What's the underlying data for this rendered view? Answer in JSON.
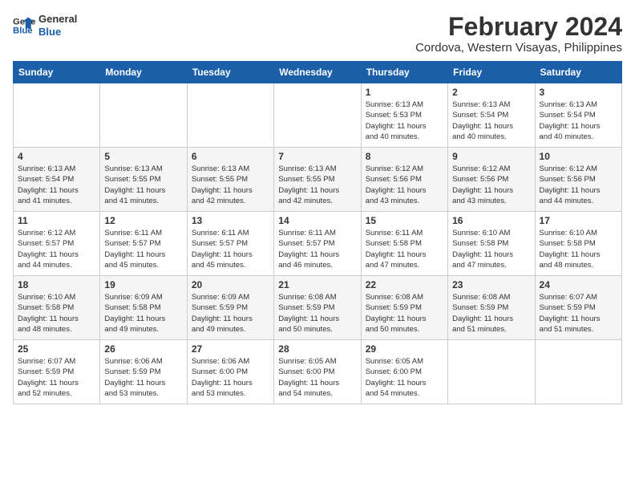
{
  "logo": {
    "line1": "General",
    "line2": "Blue"
  },
  "title": "February 2024",
  "subtitle": "Cordova, Western Visayas, Philippines",
  "days_of_week": [
    "Sunday",
    "Monday",
    "Tuesday",
    "Wednesday",
    "Thursday",
    "Friday",
    "Saturday"
  ],
  "weeks": [
    [
      {
        "day": "",
        "info": ""
      },
      {
        "day": "",
        "info": ""
      },
      {
        "day": "",
        "info": ""
      },
      {
        "day": "",
        "info": ""
      },
      {
        "day": "1",
        "info": "Sunrise: 6:13 AM\nSunset: 5:53 PM\nDaylight: 11 hours\nand 40 minutes."
      },
      {
        "day": "2",
        "info": "Sunrise: 6:13 AM\nSunset: 5:54 PM\nDaylight: 11 hours\nand 40 minutes."
      },
      {
        "day": "3",
        "info": "Sunrise: 6:13 AM\nSunset: 5:54 PM\nDaylight: 11 hours\nand 40 minutes."
      }
    ],
    [
      {
        "day": "4",
        "info": "Sunrise: 6:13 AM\nSunset: 5:54 PM\nDaylight: 11 hours\nand 41 minutes."
      },
      {
        "day": "5",
        "info": "Sunrise: 6:13 AM\nSunset: 5:55 PM\nDaylight: 11 hours\nand 41 minutes."
      },
      {
        "day": "6",
        "info": "Sunrise: 6:13 AM\nSunset: 5:55 PM\nDaylight: 11 hours\nand 42 minutes."
      },
      {
        "day": "7",
        "info": "Sunrise: 6:13 AM\nSunset: 5:55 PM\nDaylight: 11 hours\nand 42 minutes."
      },
      {
        "day": "8",
        "info": "Sunrise: 6:12 AM\nSunset: 5:56 PM\nDaylight: 11 hours\nand 43 minutes."
      },
      {
        "day": "9",
        "info": "Sunrise: 6:12 AM\nSunset: 5:56 PM\nDaylight: 11 hours\nand 43 minutes."
      },
      {
        "day": "10",
        "info": "Sunrise: 6:12 AM\nSunset: 5:56 PM\nDaylight: 11 hours\nand 44 minutes."
      }
    ],
    [
      {
        "day": "11",
        "info": "Sunrise: 6:12 AM\nSunset: 5:57 PM\nDaylight: 11 hours\nand 44 minutes."
      },
      {
        "day": "12",
        "info": "Sunrise: 6:11 AM\nSunset: 5:57 PM\nDaylight: 11 hours\nand 45 minutes."
      },
      {
        "day": "13",
        "info": "Sunrise: 6:11 AM\nSunset: 5:57 PM\nDaylight: 11 hours\nand 45 minutes."
      },
      {
        "day": "14",
        "info": "Sunrise: 6:11 AM\nSunset: 5:57 PM\nDaylight: 11 hours\nand 46 minutes."
      },
      {
        "day": "15",
        "info": "Sunrise: 6:11 AM\nSunset: 5:58 PM\nDaylight: 11 hours\nand 47 minutes."
      },
      {
        "day": "16",
        "info": "Sunrise: 6:10 AM\nSunset: 5:58 PM\nDaylight: 11 hours\nand 47 minutes."
      },
      {
        "day": "17",
        "info": "Sunrise: 6:10 AM\nSunset: 5:58 PM\nDaylight: 11 hours\nand 48 minutes."
      }
    ],
    [
      {
        "day": "18",
        "info": "Sunrise: 6:10 AM\nSunset: 5:58 PM\nDaylight: 11 hours\nand 48 minutes."
      },
      {
        "day": "19",
        "info": "Sunrise: 6:09 AM\nSunset: 5:58 PM\nDaylight: 11 hours\nand 49 minutes."
      },
      {
        "day": "20",
        "info": "Sunrise: 6:09 AM\nSunset: 5:59 PM\nDaylight: 11 hours\nand 49 minutes."
      },
      {
        "day": "21",
        "info": "Sunrise: 6:08 AM\nSunset: 5:59 PM\nDaylight: 11 hours\nand 50 minutes."
      },
      {
        "day": "22",
        "info": "Sunrise: 6:08 AM\nSunset: 5:59 PM\nDaylight: 11 hours\nand 50 minutes."
      },
      {
        "day": "23",
        "info": "Sunrise: 6:08 AM\nSunset: 5:59 PM\nDaylight: 11 hours\nand 51 minutes."
      },
      {
        "day": "24",
        "info": "Sunrise: 6:07 AM\nSunset: 5:59 PM\nDaylight: 11 hours\nand 51 minutes."
      }
    ],
    [
      {
        "day": "25",
        "info": "Sunrise: 6:07 AM\nSunset: 5:59 PM\nDaylight: 11 hours\nand 52 minutes."
      },
      {
        "day": "26",
        "info": "Sunrise: 6:06 AM\nSunset: 5:59 PM\nDaylight: 11 hours\nand 53 minutes."
      },
      {
        "day": "27",
        "info": "Sunrise: 6:06 AM\nSunset: 6:00 PM\nDaylight: 11 hours\nand 53 minutes."
      },
      {
        "day": "28",
        "info": "Sunrise: 6:05 AM\nSunset: 6:00 PM\nDaylight: 11 hours\nand 54 minutes."
      },
      {
        "day": "29",
        "info": "Sunrise: 6:05 AM\nSunset: 6:00 PM\nDaylight: 11 hours\nand 54 minutes."
      },
      {
        "day": "",
        "info": ""
      },
      {
        "day": "",
        "info": ""
      }
    ]
  ]
}
